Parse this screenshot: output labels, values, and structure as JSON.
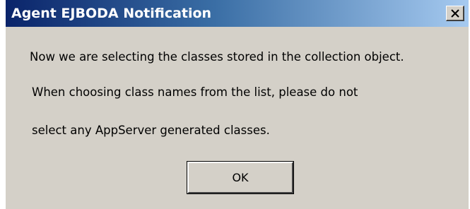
{
  "window": {
    "title": "Agent EJBODA Notification",
    "close_icon": "close-icon"
  },
  "message": {
    "line1": "Now we are selecting the classes stored in the collection object.",
    "line2": "When choosing class names from the list, please do not",
    "line3": "select any AppServer generated classes."
  },
  "buttons": {
    "ok_label": "OK"
  },
  "colors": {
    "titlebar_start": "#0a246a",
    "titlebar_end": "#a6caf0",
    "dialog_bg": "#d4d0c8"
  }
}
